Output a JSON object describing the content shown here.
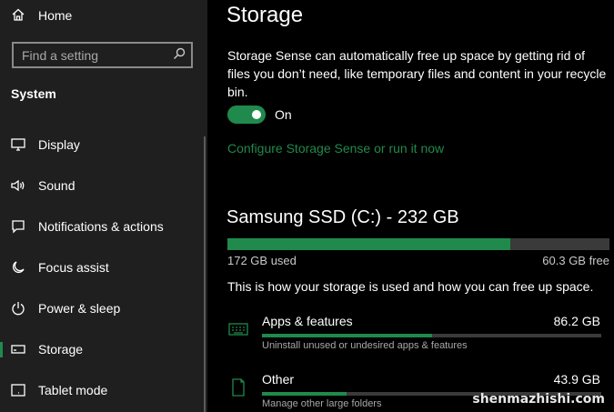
{
  "sidebar": {
    "home_label": "Home",
    "search_placeholder": "Find a setting",
    "section_title": "System",
    "items": [
      {
        "label": "Display",
        "icon": "monitor-icon"
      },
      {
        "label": "Sound",
        "icon": "speaker-icon"
      },
      {
        "label": "Notifications & actions",
        "icon": "notification-icon"
      },
      {
        "label": "Focus assist",
        "icon": "moon-icon"
      },
      {
        "label": "Power & sleep",
        "icon": "power-icon"
      },
      {
        "label": "Storage",
        "icon": "storage-icon",
        "selected": true
      },
      {
        "label": "Tablet mode",
        "icon": "tablet-icon"
      }
    ]
  },
  "main": {
    "title": "Storage",
    "description": "Storage Sense can automatically free up space by getting rid of files you don’t need, like temporary files and content in your recycle bin.",
    "toggle": {
      "state": true,
      "label": "On"
    },
    "configure_link": "Configure Storage Sense or run it now",
    "drive": {
      "title": "Samsung SSD (C:) - 232 GB",
      "used_label": "172 GB used",
      "free_label": "60.3 GB free",
      "used_fraction": 0.74
    },
    "info_line": "This is how your storage is used and how you can free up space.",
    "categories": [
      {
        "name": "Apps & features",
        "size": "86.2 GB",
        "description": "Uninstall unused or undesired apps & features",
        "fraction": 0.5,
        "icon": "keyboard-icon"
      },
      {
        "name": "Other",
        "size": "43.9 GB",
        "description": "Manage other large folders",
        "fraction": 0.25,
        "icon": "document-icon"
      }
    ]
  },
  "watermark": "shenmazhishi.com",
  "colors": {
    "accent": "#1f8a4c",
    "sidebar_bg": "#1f1f1f",
    "main_bg": "#000000",
    "track": "#3a3a3a"
  }
}
